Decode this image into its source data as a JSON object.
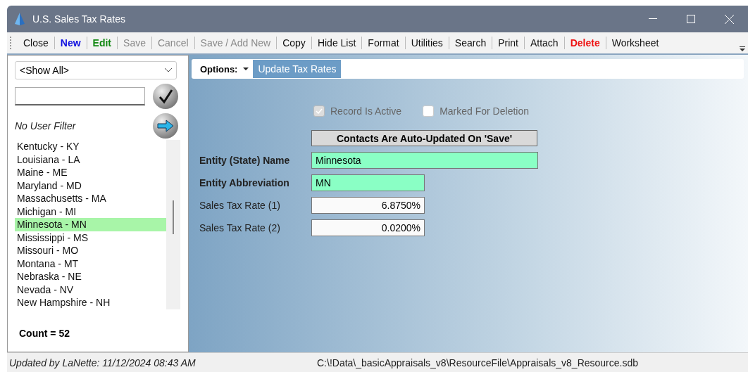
{
  "window": {
    "title": "U.S. Sales Tax Rates"
  },
  "toolbar": [
    {
      "label": "Close",
      "kind": "normal"
    },
    {
      "label": "New",
      "kind": "new"
    },
    {
      "label": "Edit",
      "kind": "edit"
    },
    {
      "label": "Save",
      "kind": "disabled"
    },
    {
      "label": "Cancel",
      "kind": "disabled"
    },
    {
      "label": "Save / Add New",
      "kind": "disabled"
    },
    {
      "label": "Copy",
      "kind": "normal"
    },
    {
      "label": "Hide List",
      "kind": "normal"
    },
    {
      "label": "Format",
      "kind": "normal"
    },
    {
      "label": "Utilities",
      "kind": "normal"
    },
    {
      "label": "Search",
      "kind": "normal"
    },
    {
      "label": "Print",
      "kind": "normal"
    },
    {
      "label": "Attach",
      "kind": "normal"
    },
    {
      "label": "Delete",
      "kind": "danger"
    },
    {
      "label": "Worksheet",
      "kind": "normal"
    }
  ],
  "sidebar": {
    "filter_dropdown": "<Show All>",
    "user_filter": "No User Filter",
    "items": [
      {
        "label": "Kentucky - KY",
        "selected": false
      },
      {
        "label": "Louisiana - LA",
        "selected": false
      },
      {
        "label": "Maine - ME",
        "selected": false
      },
      {
        "label": "Maryland - MD",
        "selected": false
      },
      {
        "label": "Massachusetts - MA",
        "selected": false
      },
      {
        "label": "Michigan - MI",
        "selected": false
      },
      {
        "label": "Minnesota - MN",
        "selected": true
      },
      {
        "label": "Mississippi - MS",
        "selected": false
      },
      {
        "label": "Missouri - MO",
        "selected": false
      },
      {
        "label": "Montana - MT",
        "selected": false
      },
      {
        "label": "Nebraska - NE",
        "selected": false
      },
      {
        "label": "Nevada - NV",
        "selected": false
      },
      {
        "label": "New Hampshire - NH",
        "selected": false
      }
    ],
    "count": "Count = 52"
  },
  "options_bar": {
    "options": "Options:",
    "action": "Update Tax Rates"
  },
  "checkboxes": [
    {
      "label": "Record Is Active",
      "checked": true,
      "disabled": true
    },
    {
      "label": "Marked For Deletion",
      "checked": false,
      "disabled": false
    }
  ],
  "banner": "Contacts Are Auto-Updated On 'Save'",
  "fields": [
    {
      "label": "Entity (State) Name",
      "value": "Minnesota",
      "required": true,
      "kind": "wide"
    },
    {
      "label": "Entity Abbreviation",
      "value": "MN",
      "required": true,
      "kind": "short"
    },
    {
      "label": "Sales Tax Rate (1)",
      "value": "6.8750%",
      "required": false,
      "kind": "number"
    },
    {
      "label": "Sales Tax Rate (2)",
      "value": "0.0200%",
      "required": false,
      "kind": "number"
    }
  ],
  "status_bar": {
    "updated": "Updated by LaNette: 11/12/2024 08:43 AM",
    "path": "C:\\!Data\\_basicAppraisals_v8\\ResourceFile\\Appraisals_v8_Resource.sdb"
  }
}
